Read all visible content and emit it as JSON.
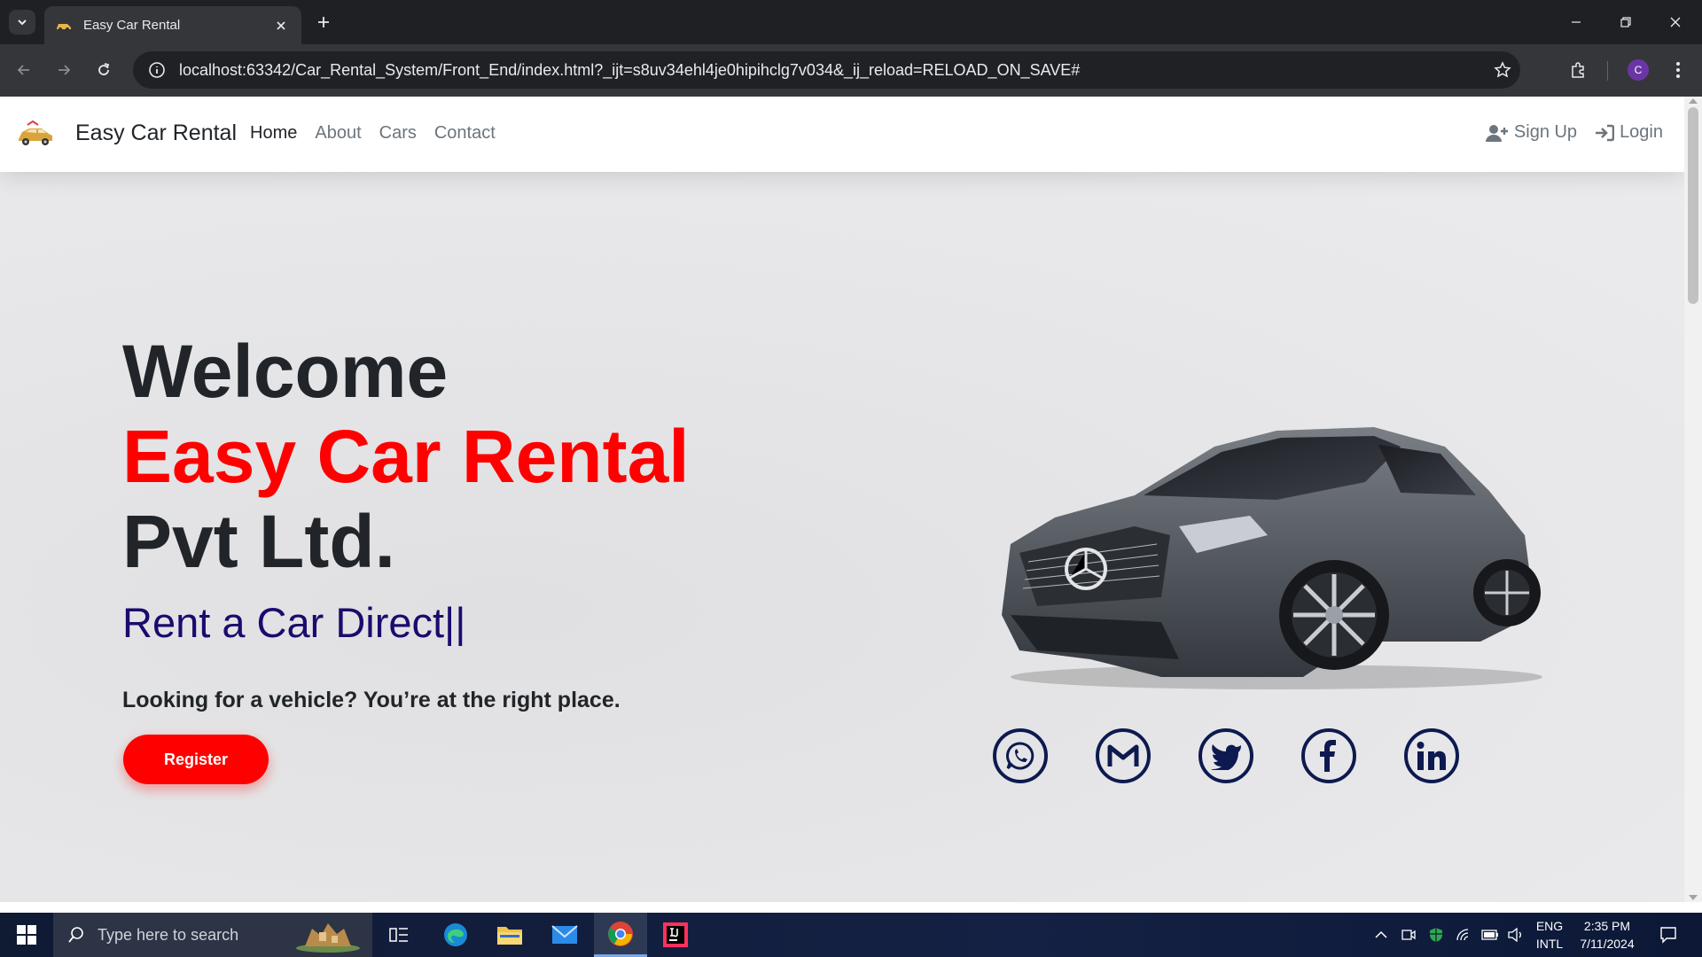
{
  "browser": {
    "tab_title": "Easy Car Rental",
    "url": "localhost:63342/Car_Rental_System/Front_End/index.html?_ijt=s8uv34ehl4je0hipihclg7v034&_ij_reload=RELOAD_ON_SAVE#",
    "profile_initial": "C"
  },
  "navbar": {
    "brand": "Easy Car Rental",
    "links": [
      "Home",
      "About",
      "Cars",
      "Contact"
    ],
    "signup": "Sign Up",
    "login": "Login"
  },
  "hero": {
    "line1": "Welcome",
    "line2": "Easy Car Rental",
    "line3": "Pvt Ltd.",
    "typed": "Rent a Car Direct||",
    "tagline": "Looking for a vehicle? You’re at the right place.",
    "register": "Register"
  },
  "socials": [
    "whatsapp-icon",
    "gmail-icon",
    "twitter-icon",
    "facebook-icon",
    "linkedin-icon"
  ],
  "taskbar": {
    "search_placeholder": "Type here to search",
    "lang": "ENG",
    "lang2": "INTL",
    "time": "2:35 PM",
    "date": "7/11/2024"
  },
  "colors": {
    "accent_red": "#ff0000",
    "typed_blue": "#1a0b6e",
    "social_navy": "#0d1a4f"
  }
}
